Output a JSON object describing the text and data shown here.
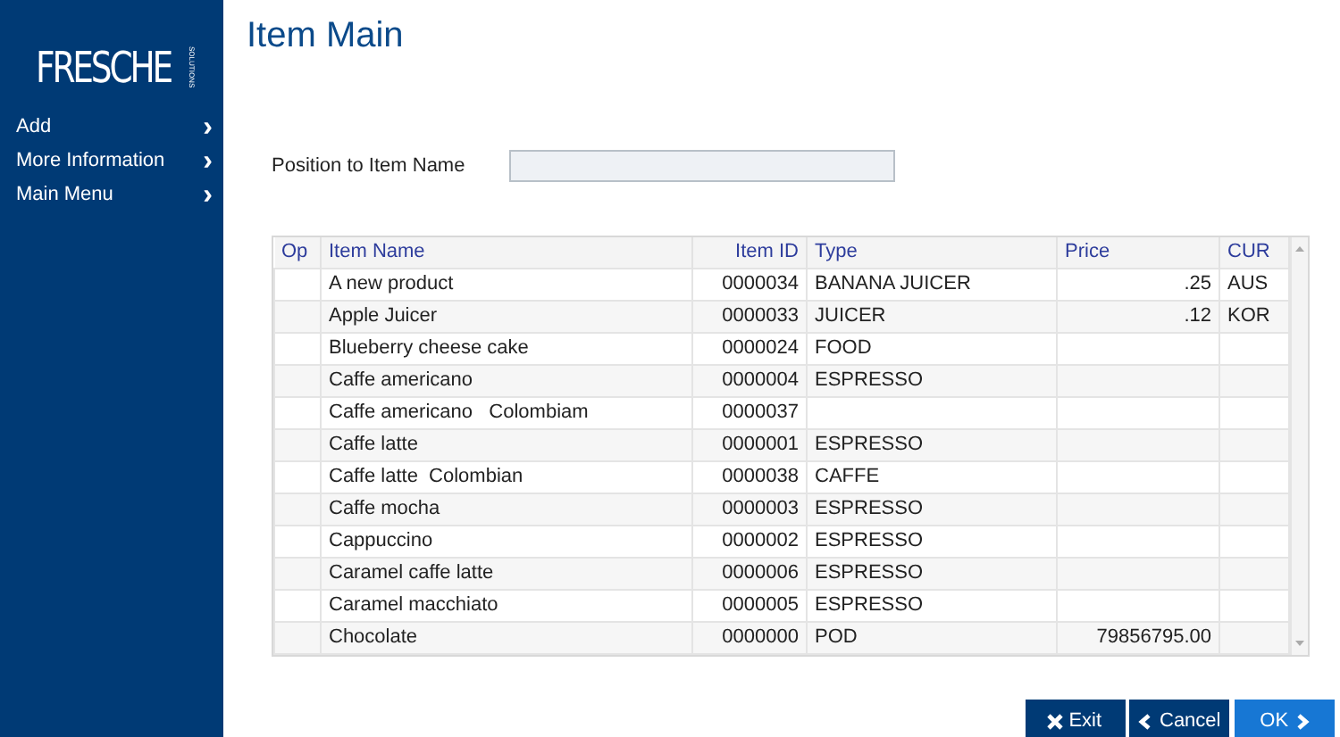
{
  "sidebar": {
    "logo": "FRESCHE",
    "logo_sub": "SOLUTIONS",
    "items": [
      {
        "label": "Add",
        "icon": "›"
      },
      {
        "label": "More Information",
        "icon": "›"
      },
      {
        "label": "Main Menu",
        "icon": "›"
      }
    ]
  },
  "page_title": "Item Main",
  "position_field": {
    "label": "Position to Item Name"
  },
  "table": {
    "columns": [
      {
        "label": "Op"
      },
      {
        "label": "Item Name"
      },
      {
        "label": "Item ID"
      },
      {
        "label": "Type"
      },
      {
        "label": "Price"
      },
      {
        "label": "CUR"
      }
    ],
    "rows": [
      [
        "",
        "A new product",
        "0000034",
        "BANANA JUICER",
        ".25",
        "AUS"
      ],
      [
        "",
        "Apple Juicer",
        "0000033",
        "JUICER",
        ".12",
        "KOR"
      ],
      [
        "",
        "Blueberry cheese cake",
        "0000024",
        "FOOD",
        "",
        ""
      ],
      [
        "",
        "Caffe americano",
        "0000004",
        "ESPRESSO",
        "",
        ""
      ],
      [
        "",
        "Caffe americano   Colombiam",
        "0000037",
        "",
        "",
        ""
      ],
      [
        "",
        "Caffe latte",
        "0000001",
        "ESPRESSO",
        "",
        ""
      ],
      [
        "",
        "Caffe latte  Colombian",
        "0000038",
        "CAFFE",
        "",
        ""
      ],
      [
        "",
        "Caffe mocha",
        "0000003",
        "ESPRESSO",
        "",
        ""
      ],
      [
        "",
        "Cappuccino",
        "0000002",
        "ESPRESSO",
        "",
        ""
      ],
      [
        "",
        "Caramel caffe latte",
        "0000006",
        "ESPRESSO",
        "",
        ""
      ],
      [
        "",
        "Caramel macchiato",
        "0000005",
        "ESPRESSO",
        "",
        ""
      ],
      [
        "",
        "Chocolate",
        "0000000",
        "POD",
        "79856795.00",
        ""
      ]
    ]
  },
  "buttons": [
    {
      "label": "Exit",
      "kind": "exit",
      "primary": false
    },
    {
      "label": "Cancel",
      "kind": "back",
      "primary": false
    },
    {
      "label": "OK",
      "kind": "next",
      "primary": true
    }
  ]
}
